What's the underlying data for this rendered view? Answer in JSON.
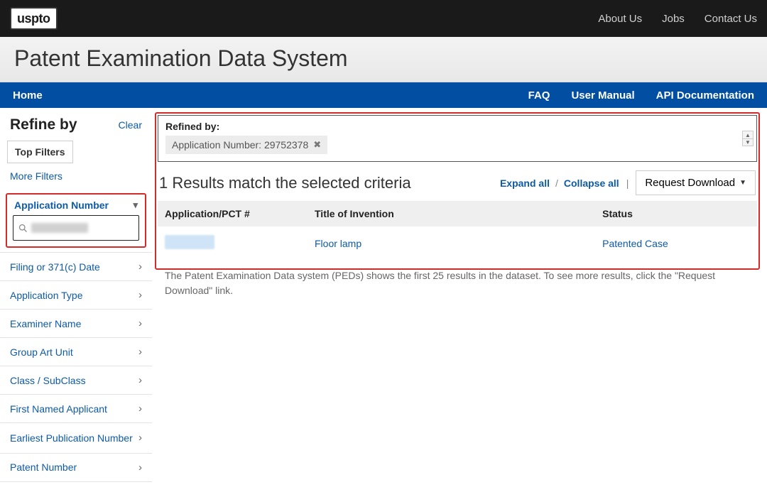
{
  "header": {
    "logo": "uspto",
    "nav": {
      "about": "About Us",
      "jobs": "Jobs",
      "contact": "Contact Us"
    }
  },
  "title": "Patent Examination Data System",
  "bluebar": {
    "home": "Home",
    "faq": "FAQ",
    "manual": "User Manual",
    "api": "API Documentation"
  },
  "sidebar": {
    "heading": "Refine by",
    "clear": "Clear",
    "top_filters": "Top Filters",
    "more_filters": "More Filters",
    "active_facet": {
      "label": "Application Number"
    },
    "facets": [
      "Filing or 371(c) Date",
      "Application Type",
      "Examiner Name",
      "Group Art Unit",
      "Class / SubClass",
      "First Named Applicant",
      "Earliest Publication Number",
      "Patent Number"
    ]
  },
  "refined": {
    "label": "Refined by:",
    "chip": "Application Number: 29752378"
  },
  "results": {
    "heading": "1 Results match the selected criteria",
    "expand": "Expand all",
    "collapse": "Collapse all",
    "download": "Request Download",
    "columns": {
      "app": "Application/PCT #",
      "title": "Title of Invention",
      "status": "Status"
    },
    "row": {
      "title": "Floor lamp",
      "status": "Patented Case"
    },
    "note": "The Patent Examination Data system (PEDs) shows the first 25 results in the dataset. To see more results, click the \"Request Download\" link."
  }
}
